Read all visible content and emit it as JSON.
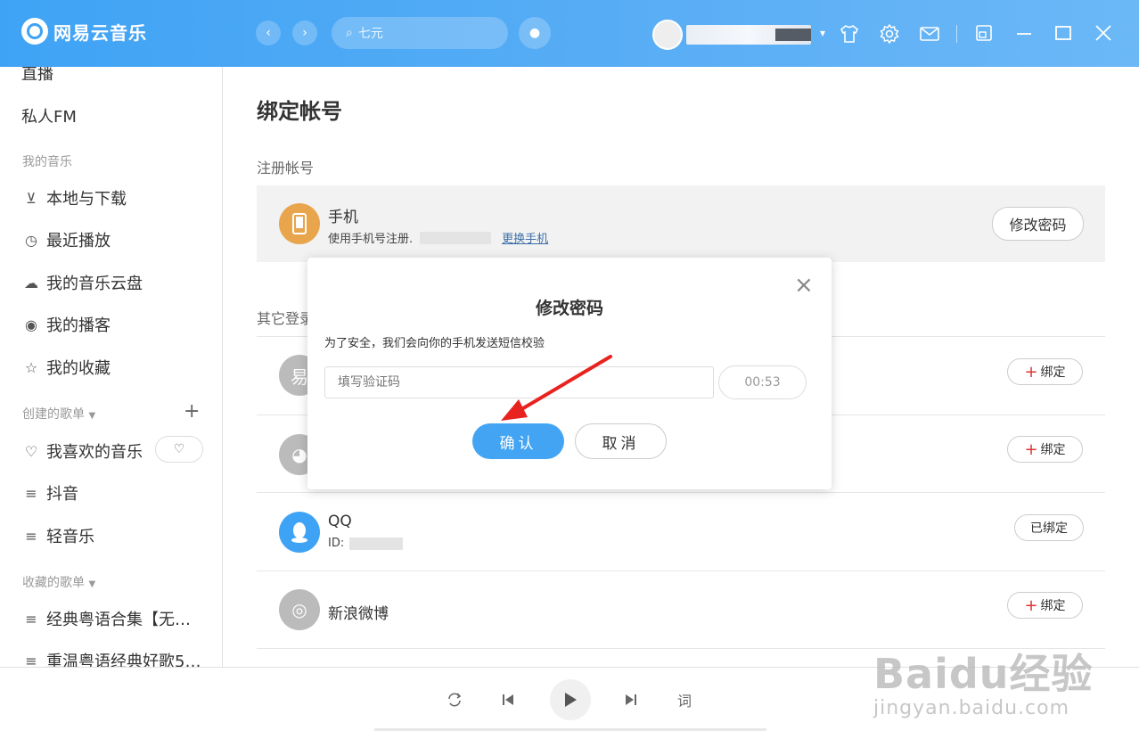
{
  "app": {
    "name": "网易云音乐"
  },
  "header": {
    "back": "‹",
    "forward": "›",
    "search_placeholder": "七元",
    "dropdown": "▾",
    "icons": [
      "skin-icon",
      "gear-icon",
      "mail-icon",
      "mini-mode-icon",
      "minimize-icon",
      "maximize-icon",
      "close-icon"
    ]
  },
  "sidebar": {
    "items_top": [
      "直播",
      "私人FM"
    ],
    "my_music_head": "我的音乐",
    "my_music": [
      "本地与下载",
      "最近播放",
      "我的音乐云盘",
      "我的播客",
      "我的收藏"
    ],
    "created_head": "创建的歌单",
    "created_plus": "+",
    "created": [
      "我喜欢的音乐",
      "抖音",
      "轻音乐"
    ],
    "collected_head": "收藏的歌单",
    "collected": [
      "经典粤语合集【无…",
      "重温粤语经典好歌5…"
    ]
  },
  "main": {
    "title": "绑定帐号",
    "registered_label": "注册帐号",
    "phone": {
      "name": "手机",
      "desc": "使用手机号注册.",
      "change_link": "更换手机",
      "change_password": "修改密码"
    },
    "other_label": "其它登录",
    "accounts": [
      {
        "name": "",
        "action": "绑定",
        "action_plus": "+"
      },
      {
        "name": "",
        "action": "绑定",
        "action_plus": "+"
      },
      {
        "name": "QQ",
        "desc": "ID:",
        "action": "已绑定"
      },
      {
        "name": "新浪微博",
        "action": "绑定",
        "action_plus": "+"
      }
    ]
  },
  "dialog": {
    "title": "修改密码",
    "close": "×",
    "tip": "为了安全，我们会向你的手机发送短信校验",
    "input_placeholder": "填写验证码",
    "countdown": "00:53",
    "confirm": "确认",
    "cancel": "取消"
  },
  "player": {
    "lyrics": "词"
  },
  "watermark": {
    "brand": "Baidu经验",
    "url": "jingyan.baidu.com"
  },
  "colors": {
    "accent": "#42a4f2",
    "topbar": "#3fa3f5",
    "arrow": "#e8231f"
  }
}
